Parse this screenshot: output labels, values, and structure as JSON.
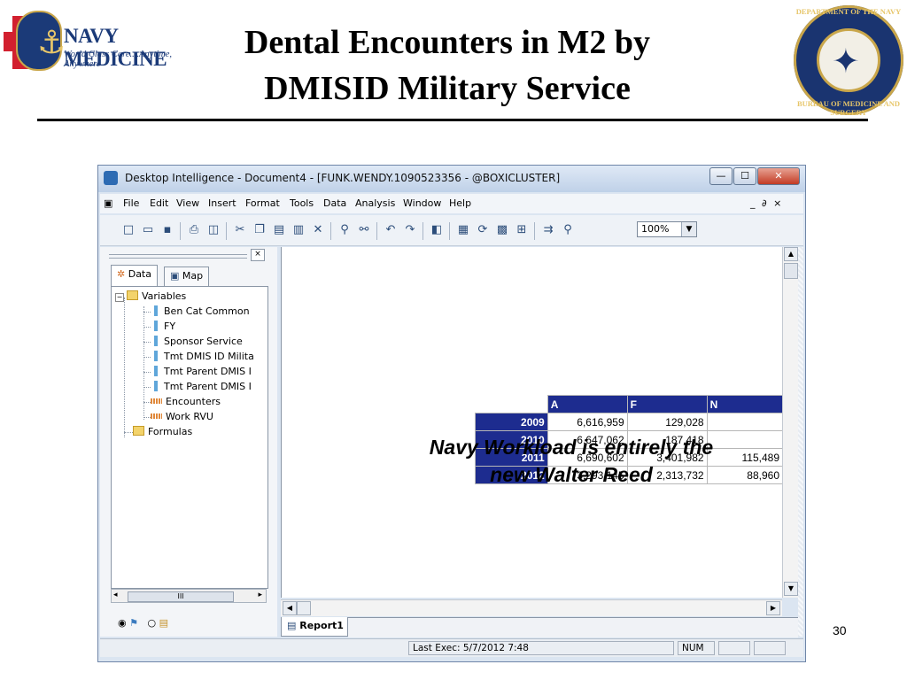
{
  "slide": {
    "title_line1": "Dental Encounters in M2 by",
    "title_line2": "DMISID Military Service",
    "page_number": "30",
    "logo_title": "NAVY MEDICINE",
    "logo_tagline": "World Class Care....Anytime, Anywhere",
    "seal_text_top": "DEPARTMENT OF THE NAVY",
    "seal_text_bottom": "BUREAU OF MEDICINE AND SURGERY",
    "callout": "Navy Workload is entirely the new Walter Reed"
  },
  "window": {
    "title": "Desktop Intelligence - Document4 - [FUNK.WENDY.1090523356 - @BOXICLUSTER]",
    "menu": [
      "File",
      "Edit",
      "View",
      "Insert",
      "Format",
      "Tools",
      "Data",
      "Analysis",
      "Window",
      "Help"
    ],
    "mdi_controls": "_ ∂ ×",
    "zoom": "100%"
  },
  "left_panel": {
    "tabs": [
      "Data",
      "Map"
    ],
    "tree": {
      "variables_label": "Variables",
      "items": [
        "Ben Cat Common",
        "FY",
        "Sponsor Service",
        "Tmt DMIS ID Milita",
        "Tmt Parent DMIS I",
        "Tmt Parent DMIS I"
      ],
      "measures": [
        "Encounters",
        "Work RVU"
      ],
      "formulas_label": "Formulas"
    },
    "scroll_thumb": "III"
  },
  "report": {
    "tab_label": "Report1",
    "columns": [
      "A",
      "F",
      "N"
    ],
    "rows": [
      {
        "year": "2009",
        "a": "6,616,959",
        "f": "129,028",
        "n": ""
      },
      {
        "year": "2010",
        "a": "6,647,062",
        "f": "187,418",
        "n": ""
      },
      {
        "year": "2011",
        "a": "6,690,602",
        "f": "3,401,982",
        "n": "115,489"
      },
      {
        "year": "2012",
        "a": "3,293,145",
        "f": "2,313,732",
        "n": "88,960"
      }
    ]
  },
  "status": {
    "last_exec": "Last Exec: 5/7/2012 7:48",
    "num": "NUM"
  },
  "colors": {
    "table_header": "#1d2c8f",
    "window_frame": "#dbe5f1"
  }
}
